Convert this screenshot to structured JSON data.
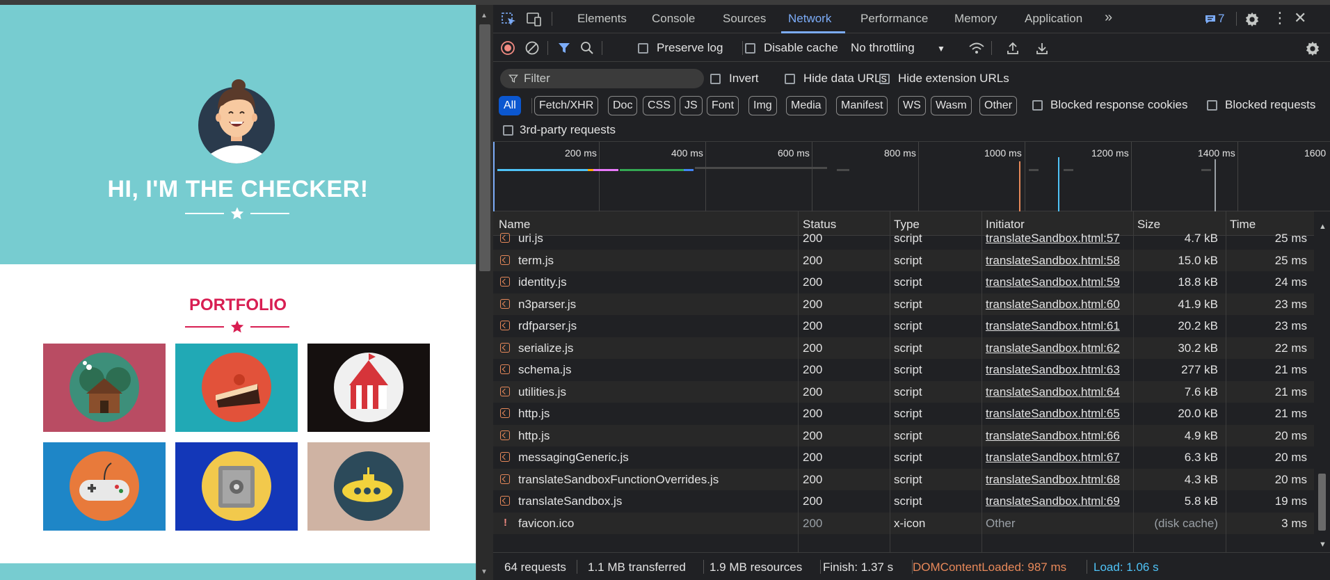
{
  "page": {
    "hero_title": "HI, I'M THE CHECKER!",
    "portfolio_title": "PORTFOLIO",
    "colors": {
      "hero_bg": "#77ccd0",
      "accent": "#d81e52"
    },
    "tiles": [
      {
        "icon": "cabin-icon",
        "bg": "#b94c63"
      },
      {
        "icon": "cake-icon",
        "bg": "#21a9b5"
      },
      {
        "icon": "circus-tent-icon",
        "bg": "#15100f"
      },
      {
        "icon": "gamepad-icon",
        "bg": "#1e86c7"
      },
      {
        "icon": "safe-icon",
        "bg": "#1337b8"
      },
      {
        "icon": "submarine-icon",
        "bg": "#cfb3a3"
      }
    ]
  },
  "devtools": {
    "tabs": [
      "Elements",
      "Console",
      "Sources",
      "Network",
      "Performance",
      "Memory",
      "Application"
    ],
    "active_tab": "Network",
    "issues_count": "7",
    "toolbar": {
      "preserve_log": "Preserve log",
      "disable_cache": "Disable cache",
      "throttling": "No throttling"
    },
    "filter": {
      "placeholder": "Filter",
      "invert": "Invert",
      "hide_data_urls": "Hide data URLs",
      "hide_extension_urls": "Hide extension URLs",
      "chips": [
        "All",
        "Fetch/XHR",
        "Doc",
        "CSS",
        "JS",
        "Font",
        "Img",
        "Media",
        "Manifest",
        "WS",
        "Wasm",
        "Other"
      ],
      "blocked_response_cookies": "Blocked response cookies",
      "blocked_requests": "Blocked requests",
      "third_party": "3rd-party requests"
    },
    "timeline": {
      "ticks": [
        "200 ms",
        "400 ms",
        "600 ms",
        "800 ms",
        "1000 ms",
        "1200 ms",
        "1400 ms",
        "1600"
      ]
    },
    "table": {
      "headers": [
        "Name",
        "Status",
        "Type",
        "Initiator",
        "Size",
        "Time"
      ],
      "rows": [
        {
          "name": "uri.js",
          "status": "200",
          "type": "script",
          "initiator": "translateSandbox.html:57",
          "size": "4.7 kB",
          "time": "25 ms"
        },
        {
          "name": "term.js",
          "status": "200",
          "type": "script",
          "initiator": "translateSandbox.html:58",
          "size": "15.0 kB",
          "time": "25 ms"
        },
        {
          "name": "identity.js",
          "status": "200",
          "type": "script",
          "initiator": "translateSandbox.html:59",
          "size": "18.8 kB",
          "time": "24 ms"
        },
        {
          "name": "n3parser.js",
          "status": "200",
          "type": "script",
          "initiator": "translateSandbox.html:60",
          "size": "41.9 kB",
          "time": "23 ms"
        },
        {
          "name": "rdfparser.js",
          "status": "200",
          "type": "script",
          "initiator": "translateSandbox.html:61",
          "size": "20.2 kB",
          "time": "23 ms"
        },
        {
          "name": "serialize.js",
          "status": "200",
          "type": "script",
          "initiator": "translateSandbox.html:62",
          "size": "30.2 kB",
          "time": "22 ms"
        },
        {
          "name": "schema.js",
          "status": "200",
          "type": "script",
          "initiator": "translateSandbox.html:63",
          "size": "277 kB",
          "time": "21 ms"
        },
        {
          "name": "utilities.js",
          "status": "200",
          "type": "script",
          "initiator": "translateSandbox.html:64",
          "size": "7.6 kB",
          "time": "21 ms"
        },
        {
          "name": "http.js",
          "status": "200",
          "type": "script",
          "initiator": "translateSandbox.html:65",
          "size": "20.0 kB",
          "time": "21 ms"
        },
        {
          "name": "http.js",
          "status": "200",
          "type": "script",
          "initiator": "translateSandbox.html:66",
          "size": "4.9 kB",
          "time": "20 ms"
        },
        {
          "name": "messagingGeneric.js",
          "status": "200",
          "type": "script",
          "initiator": "translateSandbox.html:67",
          "size": "6.3 kB",
          "time": "20 ms"
        },
        {
          "name": "translateSandboxFunctionOverrides.js",
          "status": "200",
          "type": "script",
          "initiator": "translateSandbox.html:68",
          "size": "4.3 kB",
          "time": "20 ms"
        },
        {
          "name": "translateSandbox.js",
          "status": "200",
          "type": "script",
          "initiator": "translateSandbox.html:69",
          "size": "5.8 kB",
          "time": "19 ms"
        },
        {
          "name": "favicon.ico",
          "status": "200",
          "type": "x-icon",
          "initiator": "Other",
          "size": "(disk cache)",
          "time": "3 ms",
          "error": true
        }
      ]
    },
    "summary": {
      "requests": "64 requests",
      "transferred": "1.1 MB transferred",
      "resources": "1.9 MB resources",
      "finish": "Finish: 1.37 s",
      "dcl": "DOMContentLoaded: 987 ms",
      "load": "Load: 1.06 s"
    }
  }
}
